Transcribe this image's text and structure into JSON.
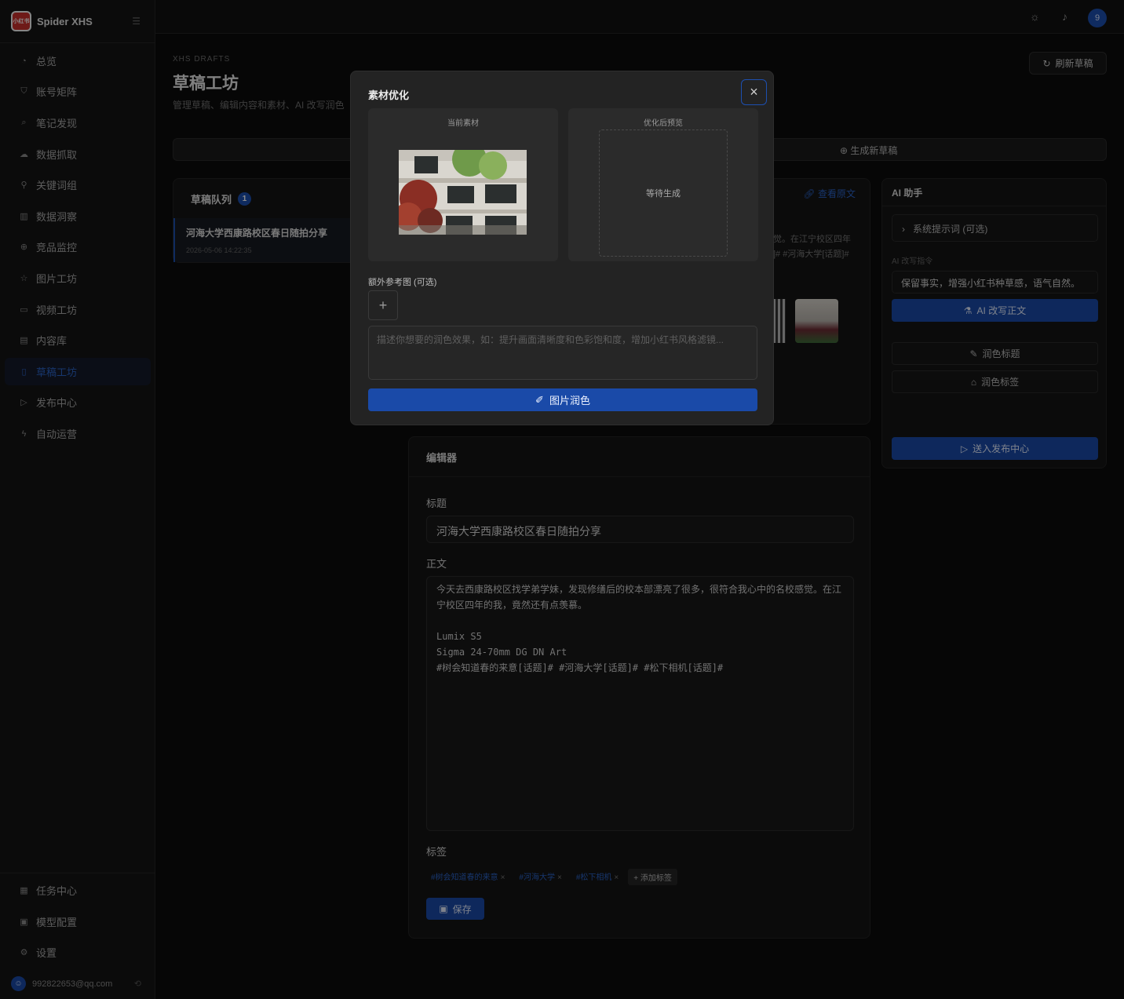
{
  "brand": {
    "name": "Spider XHS",
    "logo_text": "小红书"
  },
  "sidebar": {
    "items": [
      {
        "label": "总览",
        "icon": "dashboard-icon"
      },
      {
        "label": "账号矩阵",
        "icon": "shield-icon"
      },
      {
        "label": "笔记发现",
        "icon": "search-icon"
      },
      {
        "label": "数据抓取",
        "icon": "cloud-icon"
      },
      {
        "label": "关键词组",
        "icon": "key-icon"
      },
      {
        "label": "数据洞察",
        "icon": "bar-chart-icon"
      },
      {
        "label": "竞品监控",
        "icon": "target-icon"
      },
      {
        "label": "图片工坊",
        "icon": "star-icon"
      },
      {
        "label": "视频工坊",
        "icon": "video-icon"
      },
      {
        "label": "内容库",
        "icon": "book-icon"
      },
      {
        "label": "草稿工坊",
        "icon": "file-icon"
      },
      {
        "label": "发布中心",
        "icon": "send-icon"
      },
      {
        "label": "自动运营",
        "icon": "bolt-icon"
      }
    ],
    "active_index": 10,
    "bottom_items": [
      {
        "label": "任务中心",
        "icon": "calendar-icon"
      },
      {
        "label": "模型配置",
        "icon": "model-icon"
      },
      {
        "label": "设置",
        "icon": "gear-icon"
      }
    ],
    "user_email": "992822653@qq.com"
  },
  "topbar": {
    "avatar_text": "9"
  },
  "page": {
    "kicker": "XHS DRAFTS",
    "title": "草稿工坊",
    "description": "管理草稿、编辑内容和素材、AI 改写润色",
    "refresh_label": "刷新草稿",
    "generate_label": "生成新草稿"
  },
  "queue": {
    "title": "草稿队列",
    "count": "1",
    "items": [
      {
        "title": "河海大学西康路校区春日随拍分享",
        "date": "2026-05-06 14:22:35"
      }
    ]
  },
  "material": {
    "link_label": "查看原文",
    "snippet_1": "觉。在江宁校区四年",
    "snippet_2": "]# #河海大学[话题]#"
  },
  "editor": {
    "heading": "编辑器",
    "title_label": "标题",
    "title_value": "河海大学西康路校区春日随拍分享",
    "body_label": "正文",
    "body_value": "今天去西康路校区找学弟学妹，发现修缮后的校本部漂亮了很多，很符合我心中的名校感觉。在江宁校区四年的我，竟然还有点羡慕。\n\nLumix S5\nSigma 24-70mm DG DN Art\n#树会知道春的来意[话题]# #河海大学[话题]# #松下相机[话题]#",
    "tags_label": "标签",
    "tags": [
      "#树会知道春的来意",
      "#河海大学",
      "#松下相机"
    ],
    "add_tag_label": "+ 添加标签",
    "save_label": "保存"
  },
  "ai": {
    "heading": "AI 助手",
    "system_prompt_label": "系统提示词 (可选)",
    "instruction_label": "AI 改写指令",
    "instruction_value": "保留事实，增强小红书种草感，语气自然。",
    "rewrite_label": "AI 改写正文",
    "polish_title_label": "润色标题",
    "polish_tags_label": "润色标签",
    "send_label": "送入发布中心"
  },
  "modal": {
    "title": "素材优化",
    "current_caption": "当前素材",
    "preview_caption": "优化后预览",
    "waiting_text": "等待生成",
    "reference_label": "额外参考图 (可选)",
    "prompt_placeholder": "描述你想要的润色效果，如：提升画面清晰度和色彩饱和度，增加小红书风格滤镜...",
    "submit_label": "图片润色"
  },
  "colors": {
    "accent": "#1a4aa8",
    "link": "#2b63c7",
    "bg": "#0b0b0b",
    "panel": "#141414",
    "modal": "#232323"
  }
}
